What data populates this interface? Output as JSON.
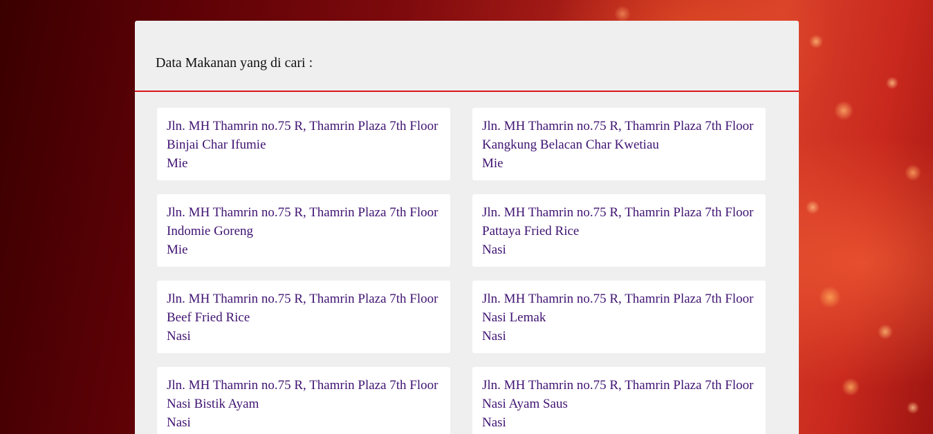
{
  "panel": {
    "title": "Data Makanan yang di cari :"
  },
  "colors": {
    "accent_line": "#d9161c",
    "card_text": "#3f1372",
    "panel_bg": "#efefef"
  },
  "results": [
    {
      "address": "Jln. MH Thamrin no.75 R, Thamrin Plaza 7th Floor",
      "name": "Binjai Char Ifumie",
      "category": "Mie"
    },
    {
      "address": "Jln. MH Thamrin no.75 R, Thamrin Plaza 7th Floor",
      "name": "Kangkung Belacan Char Kwetiau",
      "category": "Mie"
    },
    {
      "address": "Jln. MH Thamrin no.75 R, Thamrin Plaza 7th Floor",
      "name": "Indomie Goreng",
      "category": "Mie"
    },
    {
      "address": "Jln. MH Thamrin no.75 R, Thamrin Plaza 7th Floor",
      "name": "Pattaya Fried Rice",
      "category": "Nasi"
    },
    {
      "address": "Jln. MH Thamrin no.75 R, Thamrin Plaza 7th Floor",
      "name": "Beef Fried Rice",
      "category": "Nasi"
    },
    {
      "address": "Jln. MH Thamrin no.75 R, Thamrin Plaza 7th Floor",
      "name": "Nasi Lemak",
      "category": "Nasi"
    },
    {
      "address": "Jln. MH Thamrin no.75 R, Thamrin Plaza 7th Floor",
      "name": "Nasi Bistik Ayam",
      "category": "Nasi"
    },
    {
      "address": "Jln. MH Thamrin no.75 R, Thamrin Plaza 7th Floor",
      "name": "Nasi Ayam Saus",
      "category": "Nasi"
    }
  ]
}
